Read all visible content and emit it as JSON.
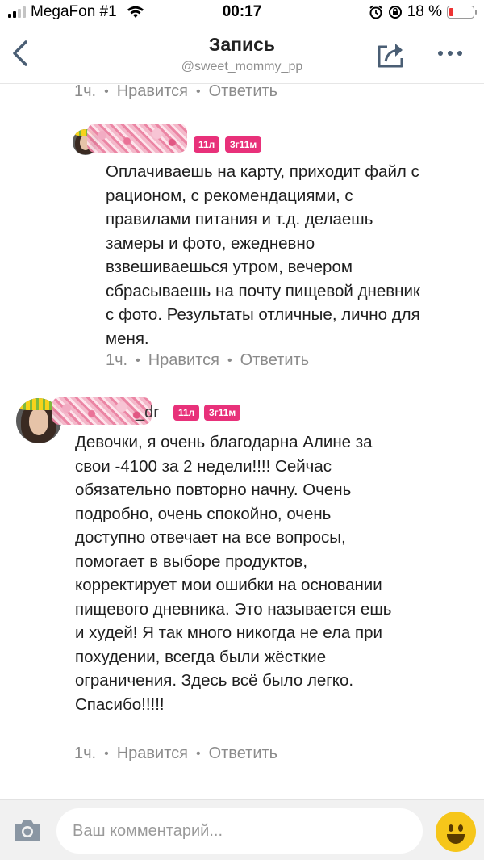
{
  "status_bar": {
    "carrier": "MegaFon #1",
    "time": "00:17",
    "battery_percent": "18 %",
    "battery_level": 0.18
  },
  "header": {
    "title": "Запись",
    "subtitle": "@sweet_mommy_pp"
  },
  "comments": [
    {
      "time": "1ч.",
      "like": "Нравится",
      "reply": "Ответить"
    },
    {
      "badges": [
        "11л",
        "3г11м"
      ],
      "text": "Оплачиваешь на карту, приходит файл с\nрационом, с рекомендациями, с\nправилами питания и т.д. делаешь\nзамеры и фото, ежедневно\nвзвешиваешься утром, вечером\nсбрасываешь на почту пищевой дневник\nс фото. Результаты отличные, лично для\nменя.",
      "time": "1ч.",
      "like": "Нравится",
      "reply": "Ответить"
    },
    {
      "name_suffix": "_dr",
      "badges": [
        "11л",
        "3г11м"
      ],
      "text": "Девочки, я очень благодарна Алине за\nсвои -4100 за 2 недели!!!! Сейчас\nобязательно повторно начну. Очень\nподробно, очень спокойно, очень\nдоступно отвечает на все вопросы,\nпомогает в выборе продуктов,\nкорректирует мои ошибки на основании\nпищевого дневника. Это называется ешь\nи худей! Я так много никогда не ела при\nпохудении, всегда были жёсткие\nограничения. Здесь всё было легко.\nСпасибо!!!!!",
      "time": "1ч.",
      "like": "Нравится",
      "reply": "Ответить"
    }
  ],
  "comment_input": {
    "placeholder": "Ваш комментарий..."
  },
  "icons": {
    "back": "chevron-left-icon",
    "share": "share-icon",
    "more": "more-dots-icon",
    "camera": "camera-icon",
    "emoji": "smiley-emoji-icon"
  },
  "colors": {
    "badge": "#e8317a",
    "meta_text": "#8b8b8b",
    "accent_gray": "#8e8e8e"
  }
}
